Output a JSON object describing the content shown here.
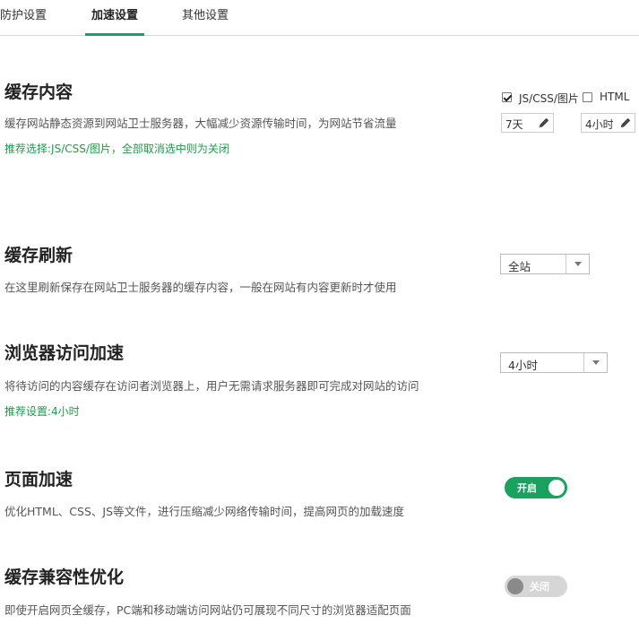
{
  "tabs": [
    {
      "label": "防护设置",
      "active": false
    },
    {
      "label": "加速设置",
      "active": true
    },
    {
      "label": "其他设置",
      "active": false
    }
  ],
  "colors": {
    "accent": "#1aa160",
    "recommend_text": "#1e9b4a",
    "toggle_off": "#d6d6d6"
  },
  "cache_content": {
    "title": "缓存内容",
    "description": "缓存网站静态资源到网站卫士服务器，大幅减少资源传输时间，为网站节省流量",
    "recommend": "推荐选择:JS/CSS/图片，全部取消选中则为关闭",
    "options": [
      {
        "label": "JS/CSS/图片",
        "checked": true,
        "duration": "7天"
      },
      {
        "label": "HTML",
        "checked": false,
        "duration": "4小时"
      }
    ],
    "edit_icon": "pencil-icon"
  },
  "cache_refresh": {
    "title": "缓存刷新",
    "description": "在这里刷新保存在网站卫士服务器的缓存内容，一般在网站有内容更新时才使用",
    "select_value": "全站"
  },
  "browser_accel": {
    "title": "浏览器访问加速",
    "description": "将待访问的内容缓存在访问者浏览器上，用户无需请求服务器即可完成对网站的访问",
    "recommend": "推荐设置:4小时",
    "select_value": "4小时"
  },
  "page_accel": {
    "title": "页面加速",
    "description": "优化HTML、CSS、JS等文件，进行压缩减少网络传输时间，提高网页的加载速度",
    "toggle_label": "开启",
    "enabled": true
  },
  "cache_compat": {
    "title": "缓存兼容性优化",
    "description": "即使开启网页全缓存，PC端和移动端访问网站仍可展现不同尺寸的浏览器适配页面",
    "toggle_label": "关闭",
    "enabled": false
  }
}
